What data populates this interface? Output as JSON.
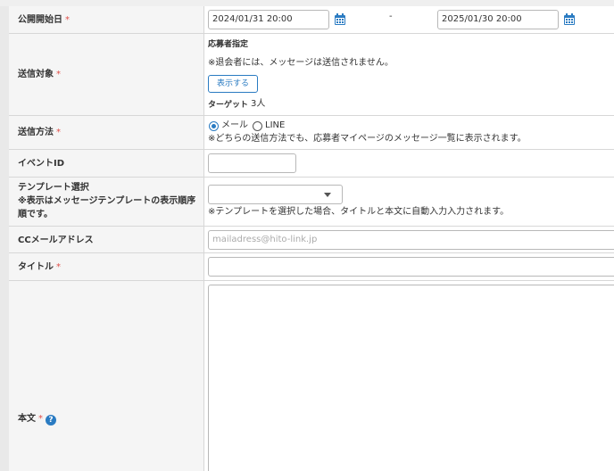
{
  "publish_start": {
    "label": "公開開始日",
    "required_mark": "*",
    "start_value": "2024/01/31 20:00",
    "separator": "-",
    "end_value": "2025/01/30 20:00",
    "calendar_icon": "calendar-icon"
  },
  "send_target": {
    "label": "送信対象",
    "required_mark": "*",
    "sublabel": "応募者指定",
    "note": "※退会者には、メッセージは送信されません。",
    "show_button": "表示する",
    "target_label": "ターゲット",
    "target_count": "3人"
  },
  "send_method": {
    "label": "送信方法",
    "required_mark": "*",
    "options": [
      "メール",
      "LINE"
    ],
    "selected": "メール",
    "note": "※どちらの送信方法でも、応募者マイページのメッセージ一覧に表示されます。"
  },
  "event_id": {
    "label": "イベントID",
    "value": ""
  },
  "template": {
    "label_line1": "テンプレート選択",
    "label_line2": "※表示はメッセージテンプレートの表示順序",
    "label_line3": "順です。",
    "selected": "",
    "note": "※テンプレートを選択した場合、タイトルと本文に自動入力入力されます。"
  },
  "cc_email": {
    "label": "CCメールアドレス",
    "placeholder": "mailadress@hito-link.jp",
    "value": ""
  },
  "title_field": {
    "label": "タイトル",
    "required_mark": "*",
    "value": ""
  },
  "body_field": {
    "label": "本文",
    "required_mark": "*",
    "help_icon": "?",
    "value": ""
  },
  "colors": {
    "accent": "#2a7bc2",
    "required": "#e0504a",
    "label_bg": "#f5f5f5",
    "border": "#d7d7d7"
  }
}
